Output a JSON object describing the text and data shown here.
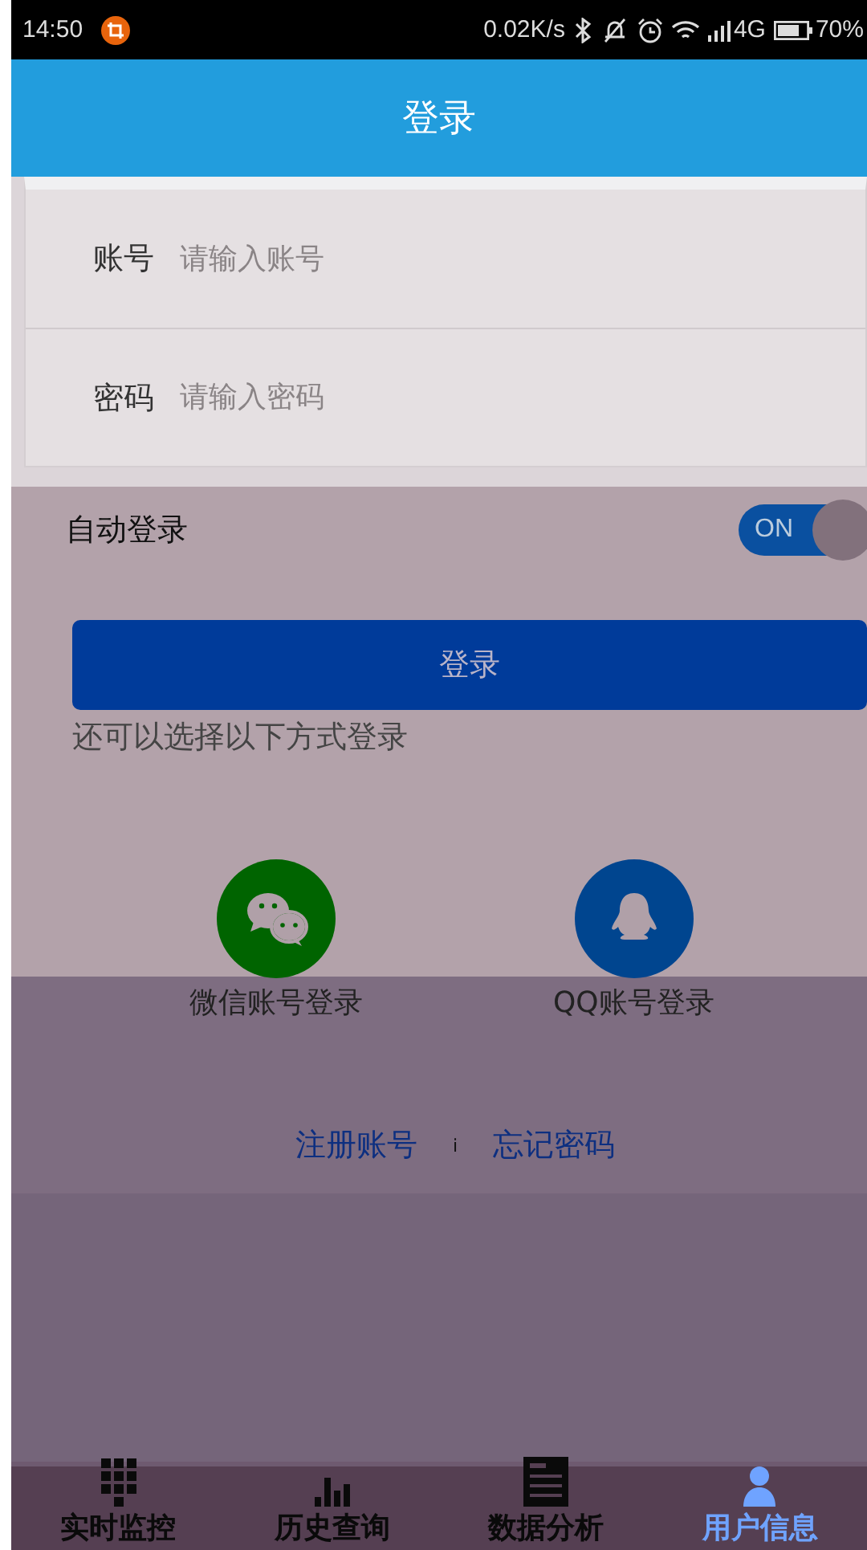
{
  "status_bar": {
    "time": "14:50",
    "speed": "0.02K/s",
    "network": "4G",
    "battery": "70%"
  },
  "header": {
    "title": "登录"
  },
  "form": {
    "fields": [
      {
        "label": "账号",
        "placeholder": "请输入账号"
      },
      {
        "label": "密码",
        "placeholder": "请输入密码"
      }
    ]
  },
  "auto_login": {
    "label": "自动登录",
    "on": true,
    "switch_text": "ON"
  },
  "login_button": "登录",
  "alt_hint": "还可以选择以下方式登录",
  "social": [
    {
      "kind": "wechat",
      "label": "微信账号登录",
      "color": "#006400"
    },
    {
      "kind": "qq",
      "label": "QQ账号登录",
      "color": "#00458f"
    }
  ],
  "links": {
    "register": "注册账号",
    "separator": "i",
    "forgot": "忘记密码"
  },
  "nav": [
    {
      "kind": "grid",
      "label": "实时监控",
      "selected": false
    },
    {
      "kind": "bars",
      "label": "历史查询",
      "selected": false
    },
    {
      "kind": "doc",
      "label": "数据分析",
      "selected": false
    },
    {
      "kind": "user",
      "label": "用户信息",
      "selected": true
    }
  ]
}
